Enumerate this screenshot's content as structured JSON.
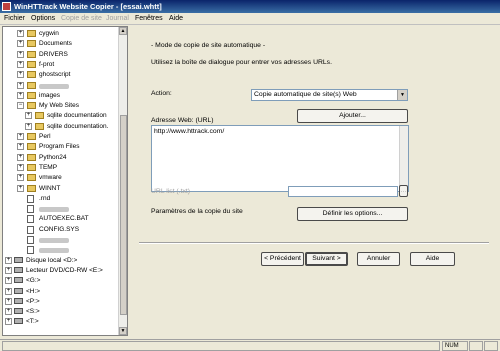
{
  "window": {
    "title": "WinHTTrack Website Copier - [essai.whtt]"
  },
  "menu": {
    "items": [
      "Fichier",
      "Options",
      "Copie de site",
      "Journal",
      "Fenêtres",
      "Aide"
    ]
  },
  "tree": {
    "items": [
      {
        "label": "cygwin",
        "kind": "folder"
      },
      {
        "label": "Documents",
        "kind": "folder"
      },
      {
        "label": "DRIVERS",
        "kind": "folder"
      },
      {
        "label": "f-prot",
        "kind": "folder"
      },
      {
        "label": "ghostscript",
        "kind": "folder"
      },
      {
        "label": "",
        "kind": "folder"
      },
      {
        "label": "images",
        "kind": "folder"
      },
      {
        "label": "My Web Sites",
        "kind": "folder"
      },
      {
        "label": "sqlite documentation",
        "kind": "folder"
      },
      {
        "label": "sqlite documentation.",
        "kind": "folder"
      },
      {
        "label": "Perl",
        "kind": "folder"
      },
      {
        "label": "Program Files",
        "kind": "folder"
      },
      {
        "label": "Python24",
        "kind": "folder"
      },
      {
        "label": "TEMP",
        "kind": "folder"
      },
      {
        "label": "vmware",
        "kind": "folder"
      },
      {
        "label": "WINNT",
        "kind": "folder"
      },
      {
        "label": ".rnd",
        "kind": "file"
      },
      {
        "label": "",
        "kind": "file"
      },
      {
        "label": "AUTOEXEC.BAT",
        "kind": "file"
      },
      {
        "label": "CONFIG.SYS",
        "kind": "file"
      },
      {
        "label": "",
        "kind": "file"
      },
      {
        "label": "",
        "kind": "file"
      },
      {
        "label": "Disque local <D:>",
        "kind": "drive"
      },
      {
        "label": "Lecteur DVD/CD-RW <E:>",
        "kind": "drive"
      },
      {
        "label": "<G:>",
        "kind": "drive"
      },
      {
        "label": "<H:>",
        "kind": "drive"
      },
      {
        "label": "<P:>",
        "kind": "drive"
      },
      {
        "label": "<S:>",
        "kind": "drive"
      },
      {
        "label": "<T:>",
        "kind": "drive"
      }
    ]
  },
  "main": {
    "heading": "- Mode de copie de site automatique -",
    "instructions": "Utilisez la boîte de dialogue pour entrer vos adresses URLs.",
    "action_label": "Action:",
    "action_value": "Copie automatique de site(s) Web",
    "add_button": "Ajouter...",
    "address_label": "Adresse Web: (URL)",
    "address_value": "http://www.httrack.com/",
    "url_list_label": "URL list (.txt)",
    "url_list_browse": "...",
    "params_label": "Paramètres de la copie du site",
    "define_options_button": "Définir les options...",
    "back_button": "< Précédent",
    "next_button": "Suivant >",
    "cancel_button": "Annuler",
    "help_button": "Aide"
  },
  "status": {
    "num": "NUM"
  }
}
